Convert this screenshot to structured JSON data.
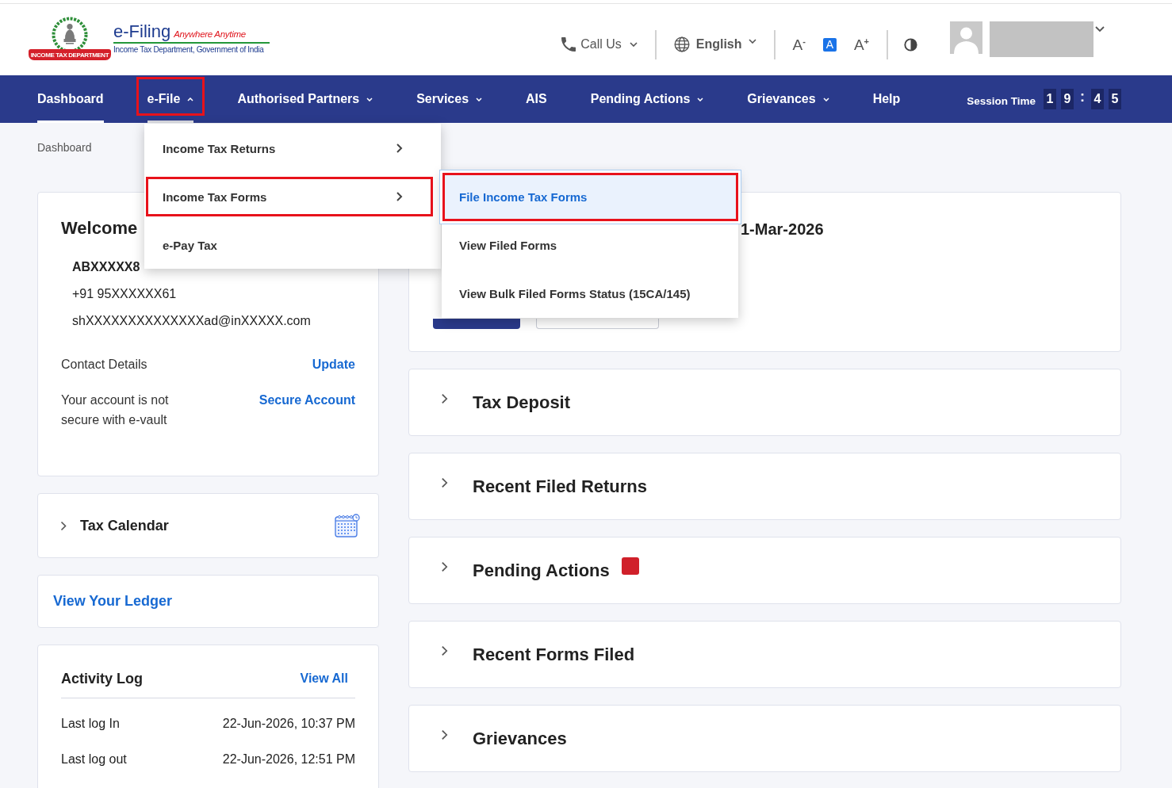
{
  "header": {
    "logo": {
      "ribbon": "INCOME TAX DEPARTMENT",
      "title": "e-Filing",
      "tagline": "Anywhere Anytime",
      "subtitle": "Income Tax Department, Government of India"
    },
    "call_us": "Call Us",
    "language": "English",
    "font_size_controls": [
      {
        "label": "A$^{-}$",
        "selected": false
      },
      {
        "label": "A",
        "selected": true
      },
      {
        "label": "A$^{+}$",
        "selected": false
      }
    ]
  },
  "nav": {
    "items": [
      {
        "label": "Dashboard",
        "kind": "link",
        "current": true,
        "selected": false
      },
      {
        "label": "e-File",
        "kind": "dropdown",
        "expanded": true,
        "current": false,
        "selected": true
      },
      {
        "label": "Authorised Partners",
        "kind": "dropdown",
        "expanded": false,
        "current": false,
        "selected": false
      },
      {
        "label": "Services",
        "kind": "dropdown",
        "expanded": false,
        "current": false,
        "selected": false
      },
      {
        "label": "AIS",
        "kind": "link",
        "current": false,
        "selected": false
      },
      {
        "label": "Pending Actions",
        "kind": "dropdown",
        "expanded": false,
        "current": false,
        "selected": false
      },
      {
        "label": "Grievances",
        "kind": "dropdown",
        "expanded": false,
        "current": false,
        "selected": false
      },
      {
        "label": "Help",
        "kind": "link",
        "current": false,
        "selected": false
      }
    ],
    "session_time": {
      "label": "Session Time",
      "time": [
        {
          "text": "1",
          "kind": "digit"
        },
        {
          "text": "9",
          "kind": "digit"
        },
        {
          "text": ":",
          "kind": "separator"
        },
        {
          "text": "4",
          "kind": "digit"
        },
        {
          "text": "5",
          "kind": "digit"
        }
      ]
    }
  },
  "efile_menu": [
    {
      "label": "Income Tax Returns",
      "kind": "submenu",
      "selected": false
    },
    {
      "label": "Income Tax Forms",
      "kind": "submenu",
      "selected": true
    },
    {
      "label": "e-Pay Tax",
      "kind": "link",
      "selected": false
    }
  ],
  "efile_submenu": [
    {
      "label": "File Income Tax Forms",
      "selected": true
    },
    {
      "label": "View Filed Forms",
      "selected": false
    },
    {
      "label": "View Bulk Filed Forms Status (15CA/145)",
      "selected": false
    }
  ],
  "breadcrumb": "Dashboard",
  "welcome_card": {
    "greeting": "Welcome",
    "pan": "ABXXXXX8",
    "phone": "+91 95XXXXXX61",
    "email": "shXXXXXXXXXXXXXXad@inXXXXX.com",
    "rows": [
      {
        "label": "Contact Details",
        "action": "Update"
      },
      {
        "label": "Your account is not secure with e-vault",
        "action": "Secure Account"
      }
    ]
  },
  "tax_calendar": {
    "title": "Tax Calendar",
    "expanded": false
  },
  "ledger_link": "View Your Ledger",
  "activity_log": {
    "title": "Activity Log",
    "action": "View All",
    "rows": [
      {
        "label": "Last log In",
        "value": "22-Jun-2026, 10:37 PM"
      },
      {
        "label": "Last log out",
        "value": "22-Jun-2026, 12:51 PM"
      }
    ]
  },
  "due_card": {
    "heading": "1-Mar-2026"
  },
  "sections": [
    {
      "title": "Tax Deposit",
      "expanded": false,
      "alert": false
    },
    {
      "title": "Recent Filed Returns",
      "expanded": false,
      "alert": false
    },
    {
      "title": "Pending Actions",
      "expanded": false,
      "alert": true
    },
    {
      "title": "Recent Forms Filed",
      "expanded": false,
      "alert": false
    },
    {
      "title": "Grievances",
      "expanded": false,
      "alert": false
    }
  ]
}
